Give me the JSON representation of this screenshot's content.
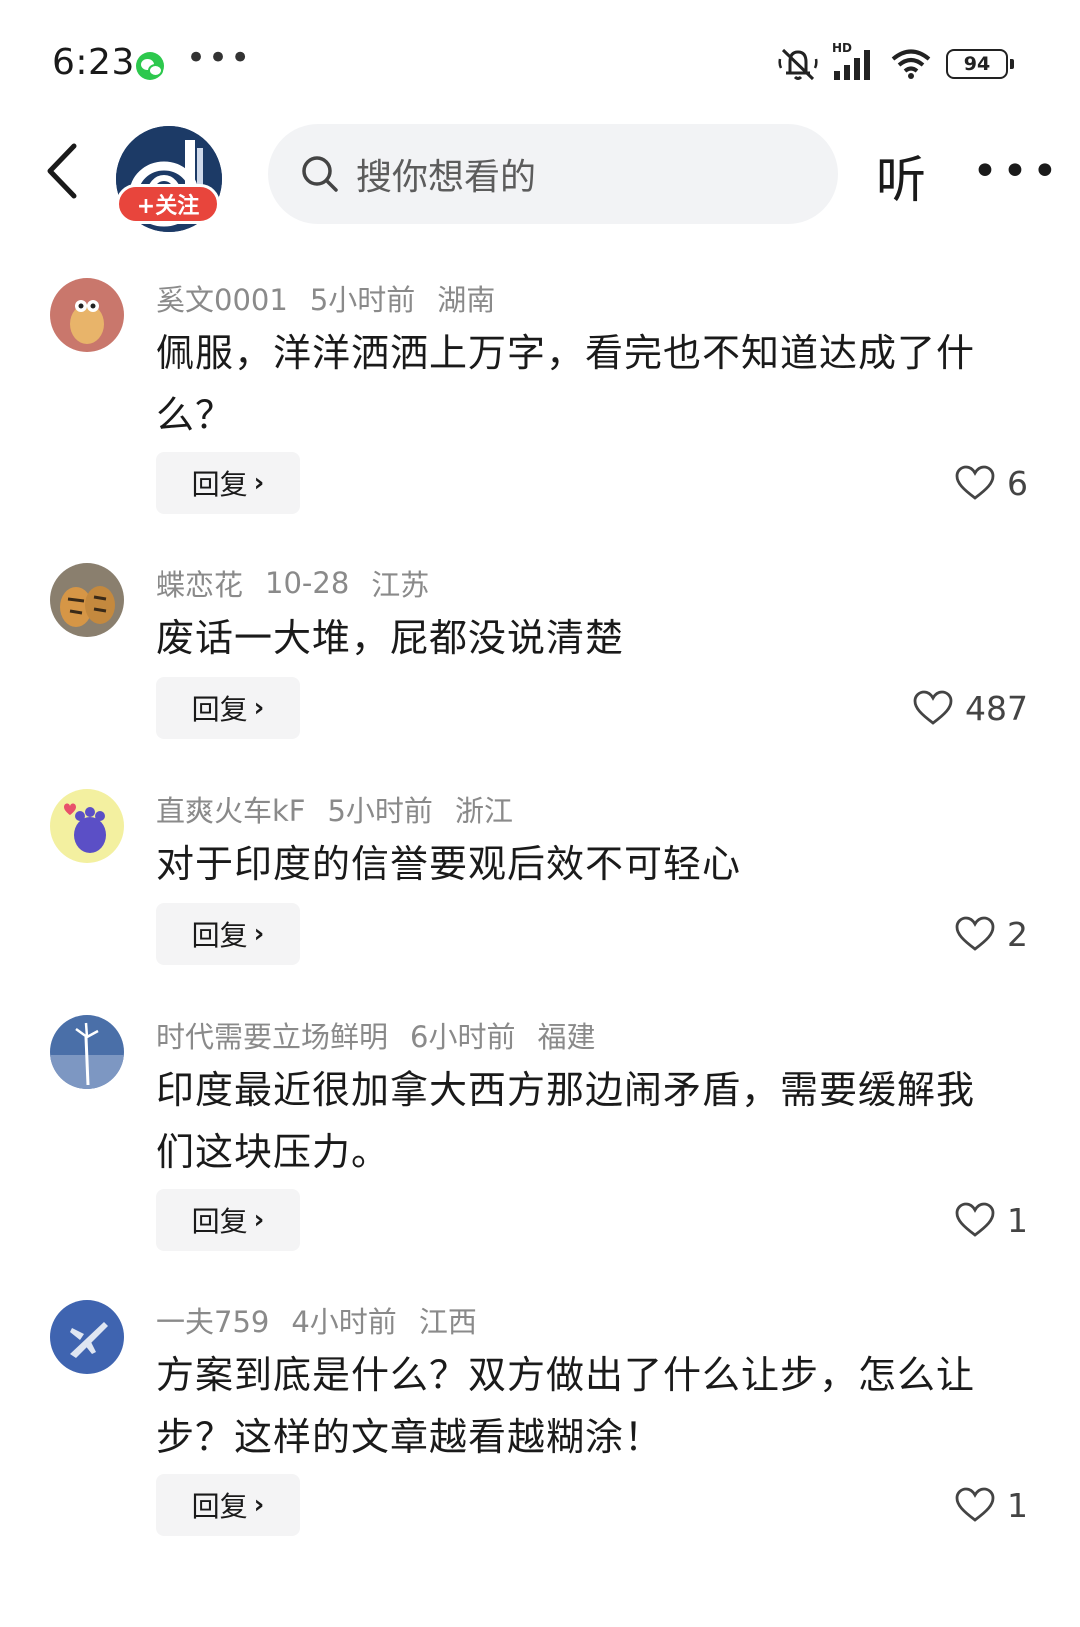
{
  "status_bar": {
    "time": "6:23",
    "battery": "94",
    "network_label": "HD",
    "icons": [
      "wechat-icon",
      "more-dots-icon",
      "mute-icon",
      "signal-icon",
      "wifi-icon",
      "battery-icon"
    ]
  },
  "nav": {
    "follow_label": "+关注",
    "search_placeholder": "搜你想看的",
    "listen_label": "听",
    "more_label": "···"
  },
  "colors": {
    "follow_badge": "#e8453c",
    "search_bg": "#f2f3f5",
    "meta_text": "#8a8a8a",
    "reply_bg": "#f4f4f5"
  },
  "comments": [
    {
      "user": "奚文0001",
      "time": "5小时前",
      "location": "湖南",
      "text": "佩服，洋洋洒洒上万字，看完也不知道达成了什么？",
      "reply_label": "回复",
      "likes": "6"
    },
    {
      "user": "蝶恋花",
      "time": "10-28",
      "location": "江苏",
      "text": "废话一大堆，屁都没说清楚",
      "reply_label": "回复",
      "likes": "487"
    },
    {
      "user": "直爽火车kF",
      "time": "5小时前",
      "location": "浙江",
      "text": "对于印度的信誉要观后效不可轻心",
      "reply_label": "回复",
      "likes": "2"
    },
    {
      "user": "时代需要立场鲜明",
      "time": "6小时前",
      "location": "福建",
      "text": "印度最近很加拿大西方那边闹矛盾，需要缓解我们这块压力。",
      "reply_label": "回复",
      "likes": "1"
    },
    {
      "user": "一夫759",
      "time": "4小时前",
      "location": "江西",
      "text": "方案到底是什么？双方做出了什么让步，怎么让步？这样的文章越看越糊涂！",
      "reply_label": "回复",
      "likes": "1"
    }
  ]
}
